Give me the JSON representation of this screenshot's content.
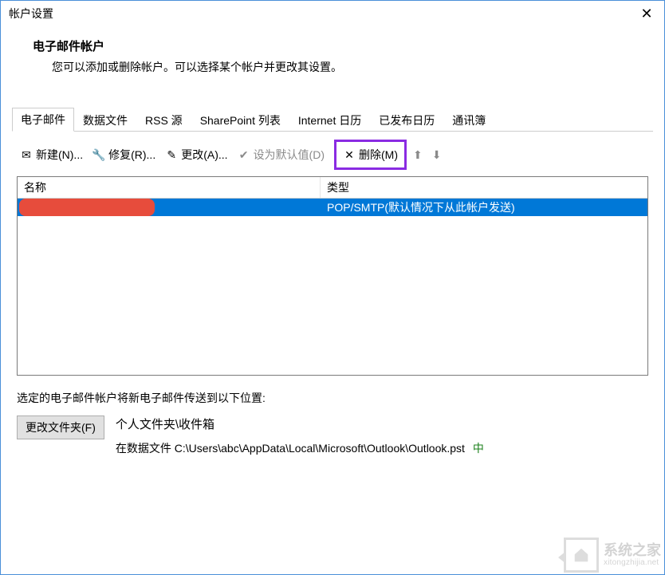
{
  "window": {
    "title": "帐户设置"
  },
  "header": {
    "title": "电子邮件帐户",
    "description": "您可以添加或删除帐户。可以选择某个帐户并更改其设置。"
  },
  "tabs": [
    {
      "label": "电子邮件",
      "active": true
    },
    {
      "label": "数据文件"
    },
    {
      "label": "RSS 源"
    },
    {
      "label": "SharePoint 列表"
    },
    {
      "label": "Internet 日历"
    },
    {
      "label": "已发布日历"
    },
    {
      "label": "通讯簿"
    }
  ],
  "toolbar": {
    "new_label": "新建(N)...",
    "repair_label": "修复(R)...",
    "change_label": "更改(A)...",
    "set_default_label": "设为默认值(D)",
    "delete_label": "删除(M)"
  },
  "table": {
    "headers": {
      "name": "名称",
      "type": "类型"
    },
    "rows": [
      {
        "name_redacted": true,
        "type": "POP/SMTP(默认情况下从此帐户发送)"
      }
    ]
  },
  "delivery": {
    "intro": "选定的电子邮件帐户将新电子邮件传送到以下位置:",
    "change_folder_label": "更改文件夹(F)",
    "folder_title": "个人文件夹\\收件箱",
    "path_prefix": "在数据文件 ",
    "path_value": "C:\\Users\\abc\\AppData\\Local\\Microsoft\\Outlook\\Outlook.pst",
    "path_suffix": "中"
  },
  "watermark": {
    "cn": "系统之家",
    "en": "xitongzhijia.net"
  },
  "icons": {
    "new": "✉",
    "repair": "🔧",
    "change": "✎",
    "set_default": "✔",
    "delete": "✕",
    "up": "⬆",
    "down": "⬇",
    "close": "✕"
  }
}
